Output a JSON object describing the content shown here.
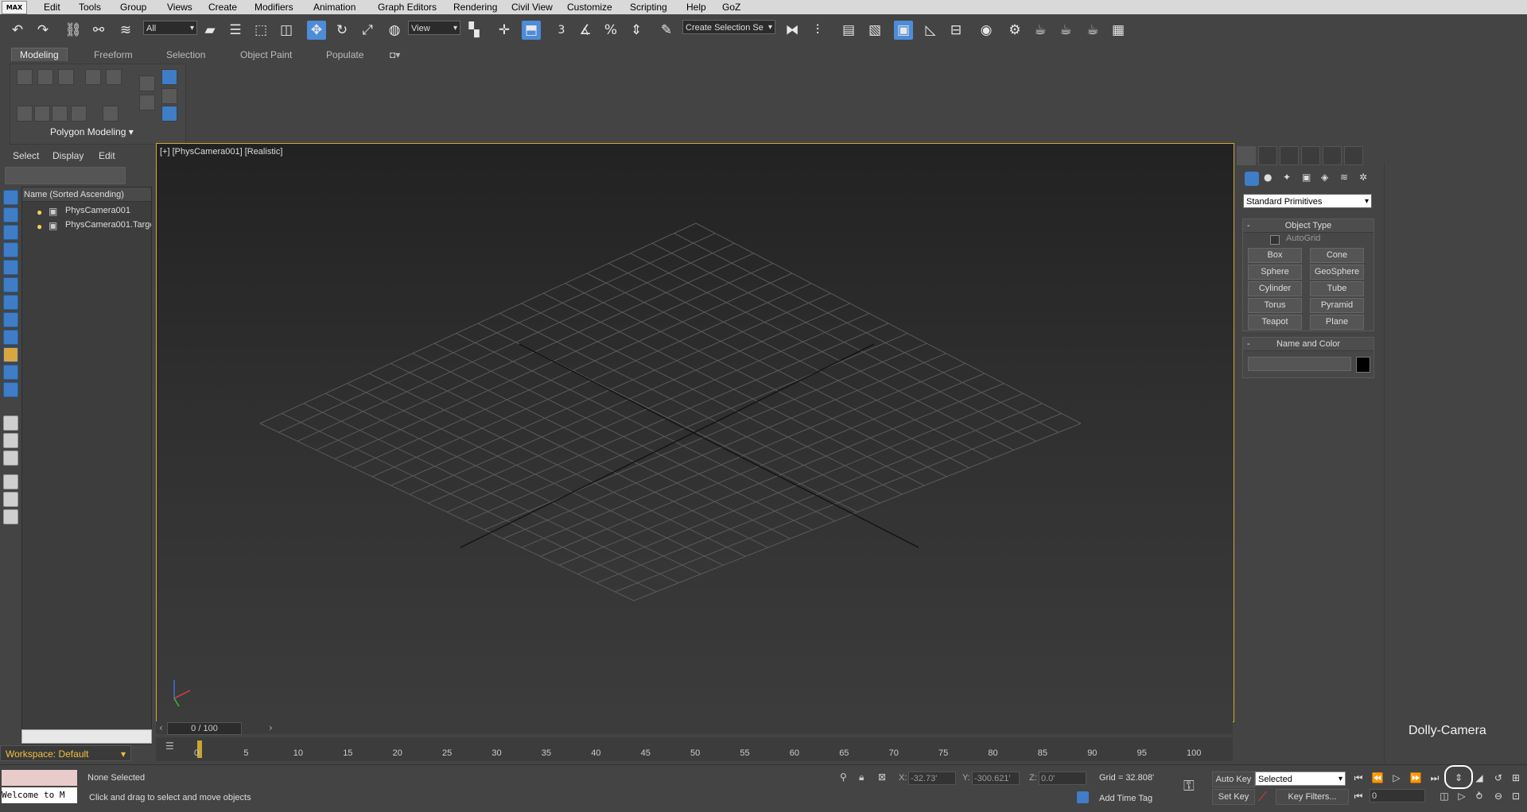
{
  "menu": {
    "logo": "MAX",
    "items": [
      "Edit",
      "Tools",
      "Group",
      "Views",
      "Create",
      "Modifiers",
      "Animation",
      "Graph Editors",
      "Rendering",
      "Civil View",
      "Customize",
      "Scripting",
      "Help",
      "GoZ"
    ]
  },
  "toolbar": {
    "filter_dropdown": "All",
    "ref_coord_dropdown": "View",
    "selection_set": "Create Selection Se",
    "snap_angle_label": "3"
  },
  "ribbon": {
    "tabs": [
      "Modeling",
      "Freeform",
      "Selection",
      "Object Paint",
      "Populate"
    ],
    "panel_label": "Polygon Modeling"
  },
  "scene_explorer": {
    "tabs": [
      "Select",
      "Display",
      "Edit"
    ],
    "column_header": "Name (Sorted Ascending)",
    "rows": [
      "PhysCamera001",
      "PhysCamera001.Target"
    ],
    "workspace": "Workspace: Default"
  },
  "viewport": {
    "label": "[+] [PhysCamera001] [Realistic]"
  },
  "timeline": {
    "thumb": "0 / 100",
    "ticks": [
      "0",
      "5",
      "10",
      "15",
      "20",
      "25",
      "30",
      "35",
      "40",
      "45",
      "50",
      "55",
      "60",
      "65",
      "70",
      "75",
      "80",
      "85",
      "90",
      "95",
      "100"
    ]
  },
  "command_panel": {
    "category_dropdown": "Standard Primitives",
    "object_type": {
      "title": "Object Type",
      "autogrid": "AutoGrid",
      "buttons": [
        "Box",
        "Cone",
        "Sphere",
        "GeoSphere",
        "Cylinder",
        "Tube",
        "Torus",
        "Pyramid",
        "Teapot",
        "Plane"
      ]
    },
    "name_and_color": {
      "title": "Name and Color",
      "name_value": "",
      "color": "#000000"
    }
  },
  "overlay": {
    "dolly_label": "Dolly-Camera"
  },
  "status": {
    "maxscript_listener": "Welcome to M",
    "selection": "None Selected",
    "prompt": "Click and drag to select and move objects",
    "x_label": "X:",
    "x_value": "-32.73'",
    "y_label": "Y:",
    "y_value": "-300.621'",
    "z_label": "Z:",
    "z_value": "0.0'",
    "grid": "Grid = 32.808'",
    "add_time_tag": "Add Time Tag",
    "auto_key": "Auto Key",
    "set_key": "Set Key",
    "selected_dropdown": "Selected",
    "key_filters": "Key Filters...",
    "frame_value": "0"
  },
  "colors": {
    "accent_blue": "#4c8cd9",
    "viewport_border": "#d2a93a",
    "workspace_text": "#f0c040"
  }
}
